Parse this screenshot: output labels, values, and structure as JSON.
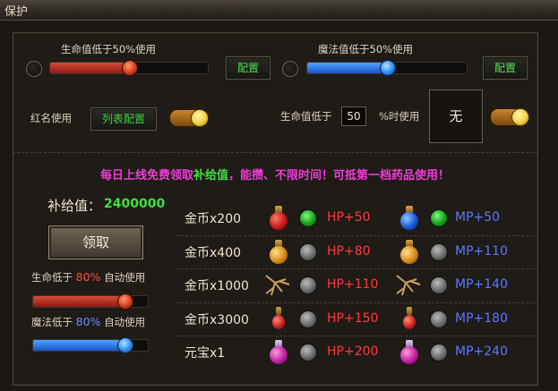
{
  "window": {
    "title": "保护"
  },
  "hp_protect": {
    "label": "生命值低于50%使用",
    "level_pct": 50,
    "config_label": "配置"
  },
  "mp_protect": {
    "label": "魔法值低于50%使用",
    "level_pct": 50,
    "config_label": "配置"
  },
  "red_name": {
    "label": "红名使用",
    "list_config_label": "列表配置"
  },
  "hp_threshold": {
    "label_prefix": "生命值低于",
    "value": "50",
    "label_suffix": "%时使用",
    "slot_label": "无"
  },
  "promo": {
    "part1": "每日上线免费领取",
    "highlight": "补给值",
    "part2": "，能攒、不限时间！可抵第一档药品使用！"
  },
  "supply": {
    "label": "补给值：",
    "value": "2400000",
    "claim_label": "领取"
  },
  "auto_hp": {
    "prefix": "生命低于",
    "pct": "80%",
    "suffix": "自动使用",
    "level_pct": 80
  },
  "auto_mp": {
    "prefix": "魔法低于",
    "pct": "80%",
    "suffix": "自动使用",
    "level_pct": 80
  },
  "tiers": [
    {
      "label": "金币x200",
      "hp": "HP+50",
      "mp": "MP+50",
      "selected": true
    },
    {
      "label": "金币x400",
      "hp": "HP+80",
      "mp": "MP+110",
      "selected": false
    },
    {
      "label": "金币x1000",
      "hp": "HP+110",
      "mp": "MP+140",
      "selected": false
    },
    {
      "label": "金币x3000",
      "hp": "HP+150",
      "mp": "MP+180",
      "selected": false
    },
    {
      "label": "元宝x1",
      "hp": "HP+200",
      "mp": "MP+240",
      "selected": false
    }
  ],
  "colors": {
    "accent_green": "#40e040",
    "hp_red": "#ff3a3a",
    "mp_blue": "#5a78ff",
    "promo_magenta": "#f03cd8"
  }
}
